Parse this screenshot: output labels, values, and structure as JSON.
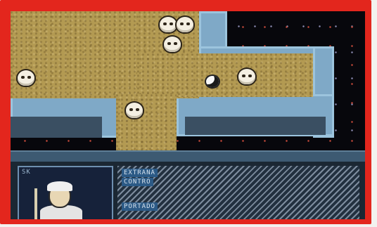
{
  "screen": {
    "title": "",
    "colors": {
      "frame": "#e3261d",
      "sand": "#b39a52",
      "wall": "#7fa9c7",
      "hud": "#1b2733"
    }
  },
  "map": {
    "enemies": [
      {
        "name": "skull-enemy"
      },
      {
        "name": "skull-enemy"
      },
      {
        "name": "skull-enemy"
      },
      {
        "name": "skull-enemy"
      },
      {
        "name": "skull-enemy"
      },
      {
        "name": "skull-enemy"
      }
    ],
    "player": {
      "icon": "hero-icon"
    }
  },
  "hud": {
    "portrait_label": "SK",
    "stat_line_1": "EXTRANA",
    "stat_line_2": "CONTRO",
    "stat_line_3": "PORTADO"
  }
}
